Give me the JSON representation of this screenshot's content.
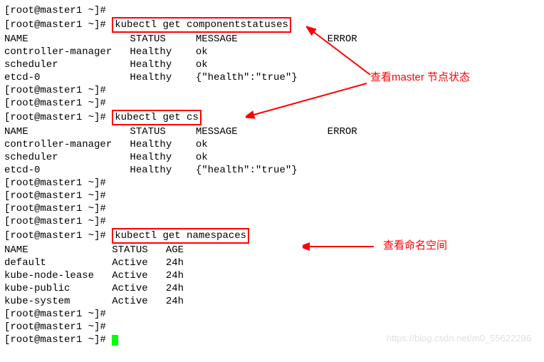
{
  "prompt": "[root@master1 ~]#",
  "cmd1": "kubectl get componentstatuses",
  "cmd2": "kubectl get cs",
  "cmd3": "kubectl get namespaces",
  "cs_header": {
    "name": "NAME",
    "status": "STATUS",
    "message": "MESSAGE",
    "error": "ERROR"
  },
  "cs_rows": [
    {
      "name": "controller-manager",
      "status": "Healthy",
      "message": "ok"
    },
    {
      "name": "scheduler",
      "status": "Healthy",
      "message": "ok"
    },
    {
      "name": "etcd-0",
      "status": "Healthy",
      "message": "{\"health\":\"true\"}"
    }
  ],
  "ns_header": {
    "name": "NAME",
    "status": "STATUS",
    "age": "AGE"
  },
  "ns_rows": [
    {
      "name": "default",
      "status": "Active",
      "age": "24h"
    },
    {
      "name": "kube-node-lease",
      "status": "Active",
      "age": "24h"
    },
    {
      "name": "kube-public",
      "status": "Active",
      "age": "24h"
    },
    {
      "name": "kube-system",
      "status": "Active",
      "age": "24h"
    }
  ],
  "annotations": {
    "master_status": "查看master 节点状态",
    "namespaces": "查看命名空间"
  },
  "watermark": "https://blog.csdn.net/m0_55622296"
}
